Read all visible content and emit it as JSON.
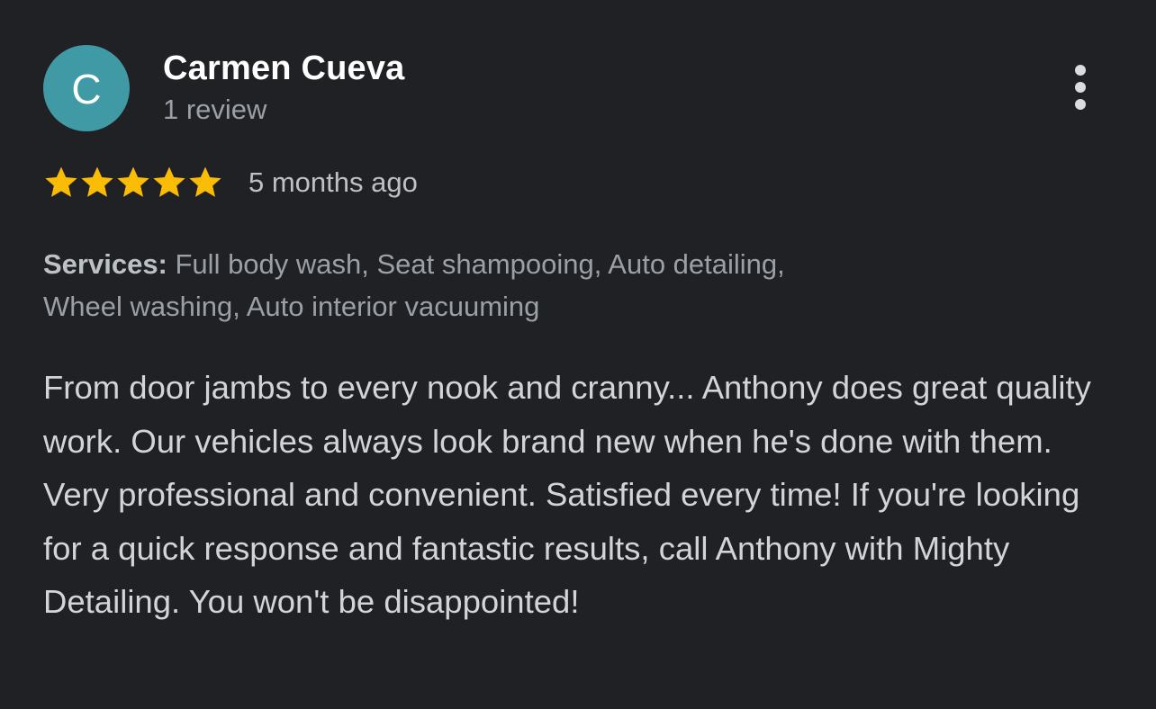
{
  "reviewer": {
    "initial": "C",
    "name": "Carmen Cueva",
    "review_count": "1 review"
  },
  "rating": {
    "stars": 5,
    "max_stars": 5,
    "date": "5 months ago"
  },
  "services": {
    "label": "Services:",
    "list": "Full body wash, Seat shampooing, Auto detailing,",
    "list_line2": "Wheel washing, Auto interior vacuuming"
  },
  "review_text": "From door jambs to every nook and cranny... Anthony does great quality work. Our vehicles always look brand new when he's done with them. Very professional and convenient. Satisfied every time! If you're looking for a quick response and fantastic results, call Anthony with Mighty Detailing. You won't be disappointed!",
  "colors": {
    "background": "#202124",
    "avatar": "#3f9aa6",
    "star": "#fbbc04"
  },
  "icons": {
    "more": "more-vert-icon",
    "star": "star-icon"
  }
}
